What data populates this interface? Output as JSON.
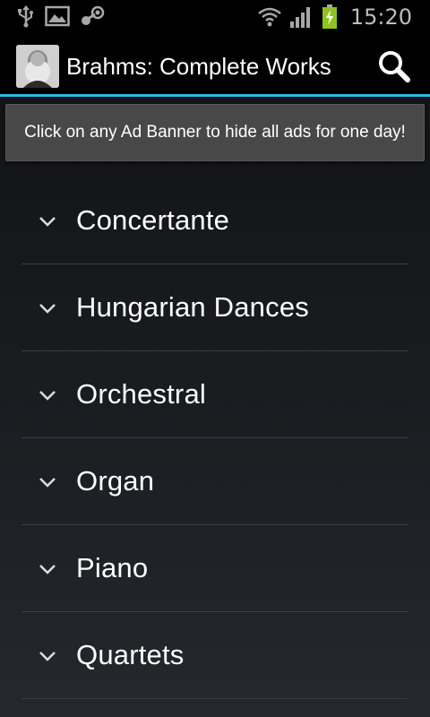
{
  "status_bar": {
    "time": "15:20",
    "icons": [
      "usb-icon",
      "image-icon",
      "steam-icon",
      "wifi-icon",
      "signal-icon",
      "battery-charging-icon"
    ]
  },
  "action_bar": {
    "title": "Brahms: Complete Works",
    "avatar": "brahms-portrait-icon",
    "search_icon": "search-icon"
  },
  "ad_banner": {
    "text": "Click on any Ad Banner to hide all ads for one day!"
  },
  "categories": [
    {
      "label": "Concertante"
    },
    {
      "label": "Hungarian Dances"
    },
    {
      "label": "Orchestral"
    },
    {
      "label": "Organ"
    },
    {
      "label": "Piano"
    },
    {
      "label": "Quartets"
    }
  ],
  "colors": {
    "accent": "#33b5e5",
    "background": "#1b1d20",
    "text": "#ffffff"
  }
}
